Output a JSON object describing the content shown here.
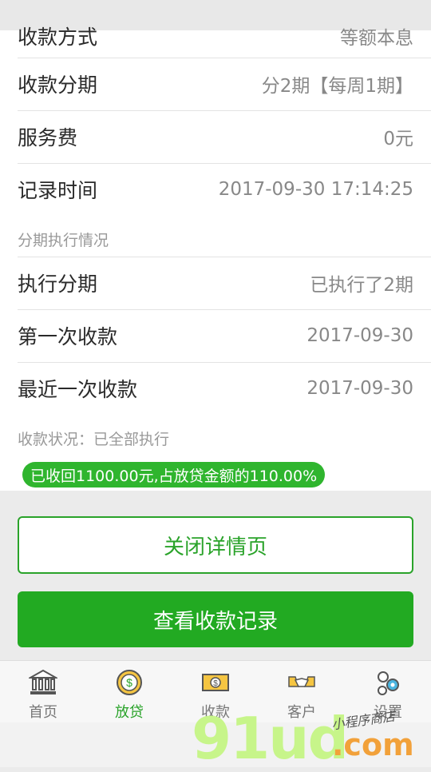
{
  "detail": {
    "rows": [
      {
        "label": "收款方式",
        "value": "等额本息"
      },
      {
        "label": "收款分期",
        "value": "分2期【每周1期】"
      },
      {
        "label": "服务费",
        "value": "0元"
      },
      {
        "label": "记录时间",
        "value": "2017-09-30 17:14:25"
      }
    ],
    "section_title": "分期执行情况",
    "exec_rows": [
      {
        "label": "执行分期",
        "value": "已执行了2期"
      },
      {
        "label": "第一次收款",
        "value": "2017-09-30"
      },
      {
        "label": "最近一次收款",
        "value": "2017-09-30"
      }
    ],
    "status_text": "收款状况：已全部执行",
    "summary_badge": "已收回1100.00元,占放贷金额的110.00%"
  },
  "buttons": {
    "close_label": "关闭详情页",
    "records_label": "查看收款记录"
  },
  "tabbar": {
    "items": [
      {
        "label": "首页",
        "icon": "bank-icon"
      },
      {
        "label": "放贷",
        "icon": "coin-icon",
        "active": true
      },
      {
        "label": "收款",
        "icon": "cash-icon"
      },
      {
        "label": "客户",
        "icon": "handshake-icon"
      },
      {
        "label": "设置",
        "icon": "gears-icon"
      }
    ]
  },
  "watermark": {
    "logo": "91ud",
    "suffix": ".com",
    "store": "小程序商店"
  },
  "colors": {
    "accent": "#22aa22",
    "badge": "#2fb52e"
  }
}
